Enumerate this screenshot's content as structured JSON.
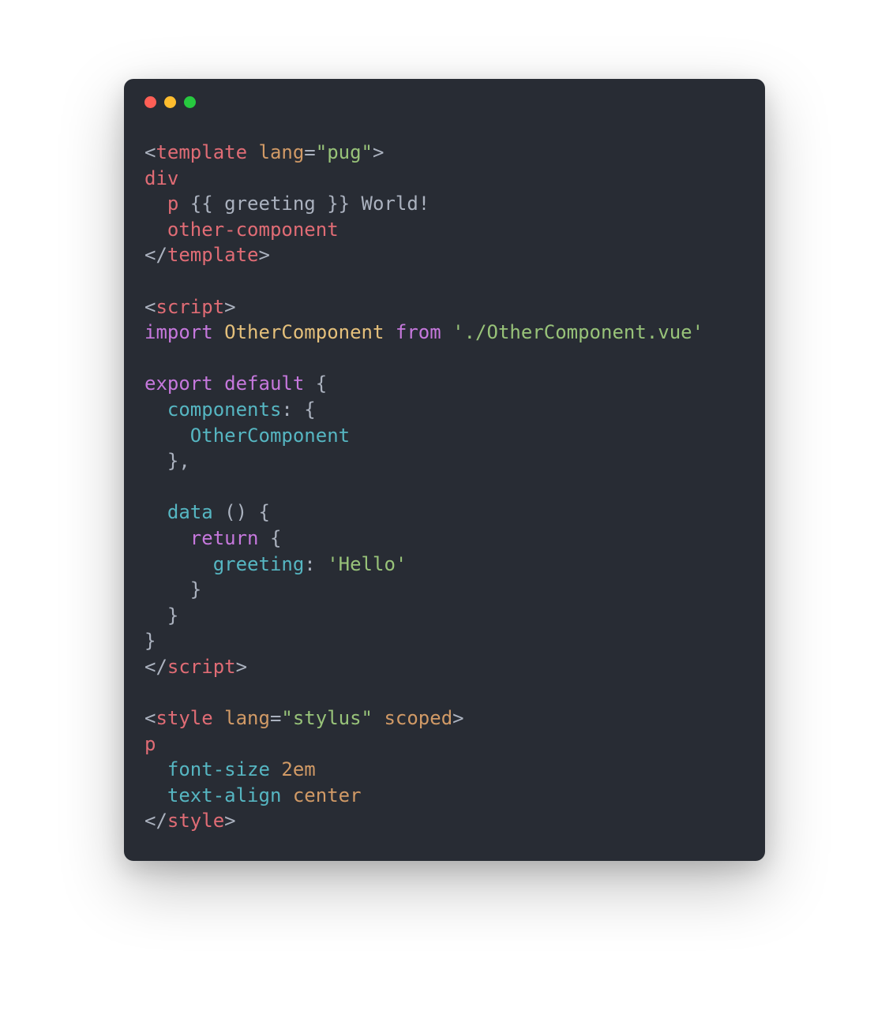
{
  "code": {
    "tokens": [
      [
        [
          "<",
          "c-punc"
        ],
        [
          "template",
          "c-tag"
        ],
        [
          " ",
          "c-punc"
        ],
        [
          "lang",
          "c-attr"
        ],
        [
          "=",
          "c-punc"
        ],
        [
          "\"pug\"",
          "c-string"
        ],
        [
          ">",
          "c-punc"
        ]
      ],
      [
        [
          "div",
          "c-tag"
        ]
      ],
      [
        [
          "  ",
          "c-punc"
        ],
        [
          "p",
          "c-tag"
        ],
        [
          " {{ ",
          "c-punc"
        ],
        [
          "greeting",
          "c-ident"
        ],
        [
          " }} World!",
          "c-punc"
        ]
      ],
      [
        [
          "  ",
          "c-punc"
        ],
        [
          "other-component",
          "c-tag"
        ]
      ],
      [
        [
          "</",
          "c-punc"
        ],
        [
          "template",
          "c-tag"
        ],
        [
          ">",
          "c-punc"
        ]
      ],
      [
        [
          "",
          ""
        ]
      ],
      [
        [
          "<",
          "c-punc"
        ],
        [
          "script",
          "c-tag"
        ],
        [
          ">",
          "c-punc"
        ]
      ],
      [
        [
          "import",
          "c-kw"
        ],
        [
          " ",
          "c-punc"
        ],
        [
          "OtherComponent",
          "c-var"
        ],
        [
          " ",
          "c-punc"
        ],
        [
          "from",
          "c-kw"
        ],
        [
          " ",
          "c-punc"
        ],
        [
          "'./OtherComponent.vue'",
          "c-string"
        ]
      ],
      [
        [
          "",
          ""
        ]
      ],
      [
        [
          "export",
          "c-kw"
        ],
        [
          " ",
          "c-punc"
        ],
        [
          "default",
          "c-kw"
        ],
        [
          " {",
          "c-punc"
        ]
      ],
      [
        [
          "  ",
          "c-punc"
        ],
        [
          "components",
          "c-prop"
        ],
        [
          ": {",
          "c-punc"
        ]
      ],
      [
        [
          "    ",
          "c-punc"
        ],
        [
          "OtherComponent",
          "c-prop"
        ]
      ],
      [
        [
          "  },",
          "c-punc"
        ]
      ],
      [
        [
          "",
          ""
        ]
      ],
      [
        [
          "  ",
          "c-punc"
        ],
        [
          "data",
          "c-prop"
        ],
        [
          " () {",
          "c-punc"
        ]
      ],
      [
        [
          "    ",
          "c-punc"
        ],
        [
          "return",
          "c-kw"
        ],
        [
          " {",
          "c-punc"
        ]
      ],
      [
        [
          "      ",
          "c-punc"
        ],
        [
          "greeting",
          "c-prop"
        ],
        [
          ": ",
          "c-punc"
        ],
        [
          "'Hello'",
          "c-string"
        ]
      ],
      [
        [
          "    }",
          "c-punc"
        ]
      ],
      [
        [
          "  }",
          "c-punc"
        ]
      ],
      [
        [
          "}",
          "c-punc"
        ]
      ],
      [
        [
          "</",
          "c-punc"
        ],
        [
          "script",
          "c-tag"
        ],
        [
          ">",
          "c-punc"
        ]
      ],
      [
        [
          "",
          ""
        ]
      ],
      [
        [
          "<",
          "c-punc"
        ],
        [
          "style",
          "c-tag"
        ],
        [
          " ",
          "c-punc"
        ],
        [
          "lang",
          "c-attr"
        ],
        [
          "=",
          "c-punc"
        ],
        [
          "\"stylus\"",
          "c-string"
        ],
        [
          " ",
          "c-punc"
        ],
        [
          "scoped",
          "c-attr"
        ],
        [
          ">",
          "c-punc"
        ]
      ],
      [
        [
          "p",
          "c-tag"
        ]
      ],
      [
        [
          "  ",
          "c-punc"
        ],
        [
          "font-size",
          "c-prop"
        ],
        [
          " ",
          "c-punc"
        ],
        [
          "2em",
          "c-num"
        ]
      ],
      [
        [
          "  ",
          "c-punc"
        ],
        [
          "text-align",
          "c-prop"
        ],
        [
          " ",
          "c-punc"
        ],
        [
          "center",
          "c-num"
        ]
      ],
      [
        [
          "</",
          "c-punc"
        ],
        [
          "style",
          "c-tag"
        ],
        [
          ">",
          "c-punc"
        ]
      ]
    ]
  }
}
